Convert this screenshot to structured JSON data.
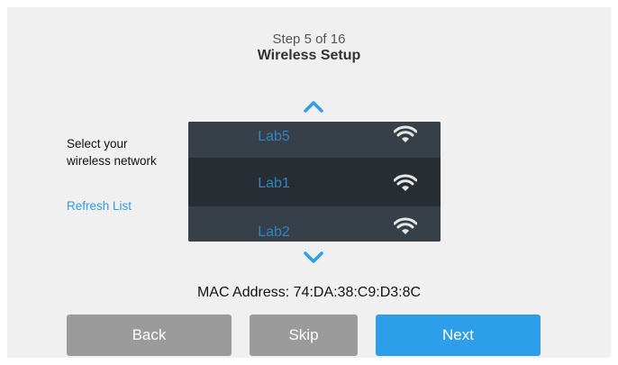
{
  "header": {
    "step": "Step 5 of 16",
    "title": "Wireless Setup"
  },
  "instructions": {
    "select_label": "Select your wireless network",
    "refresh_label": "Refresh List"
  },
  "networks": [
    {
      "name": "Lab5",
      "icon": "wifi-icon"
    },
    {
      "name": "Lab1",
      "icon": "wifi-icon",
      "selected": true
    },
    {
      "name": "Lab2",
      "icon": "wifi-icon"
    }
  ],
  "mac": {
    "text": "MAC Address: 74:DA:38:C9:D3:8C"
  },
  "buttons": {
    "back": "Back",
    "skip": "Skip",
    "next": "Next"
  },
  "colors": {
    "accent": "#2d9ee9",
    "button_gray": "#9b9b9b",
    "list_bg": "#303940",
    "list_selected": "#272e33",
    "network_text": "#2f84c3"
  }
}
